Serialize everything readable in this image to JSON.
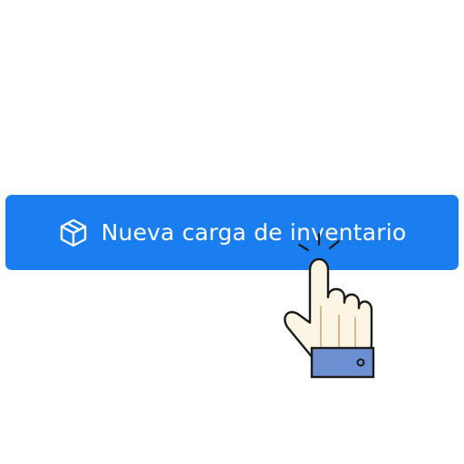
{
  "button": {
    "label": "Nueva carga de inventario",
    "icon": "box-icon",
    "color": "#1a7ef0"
  },
  "cursor": {
    "icon": "hand-pointer-icon"
  }
}
